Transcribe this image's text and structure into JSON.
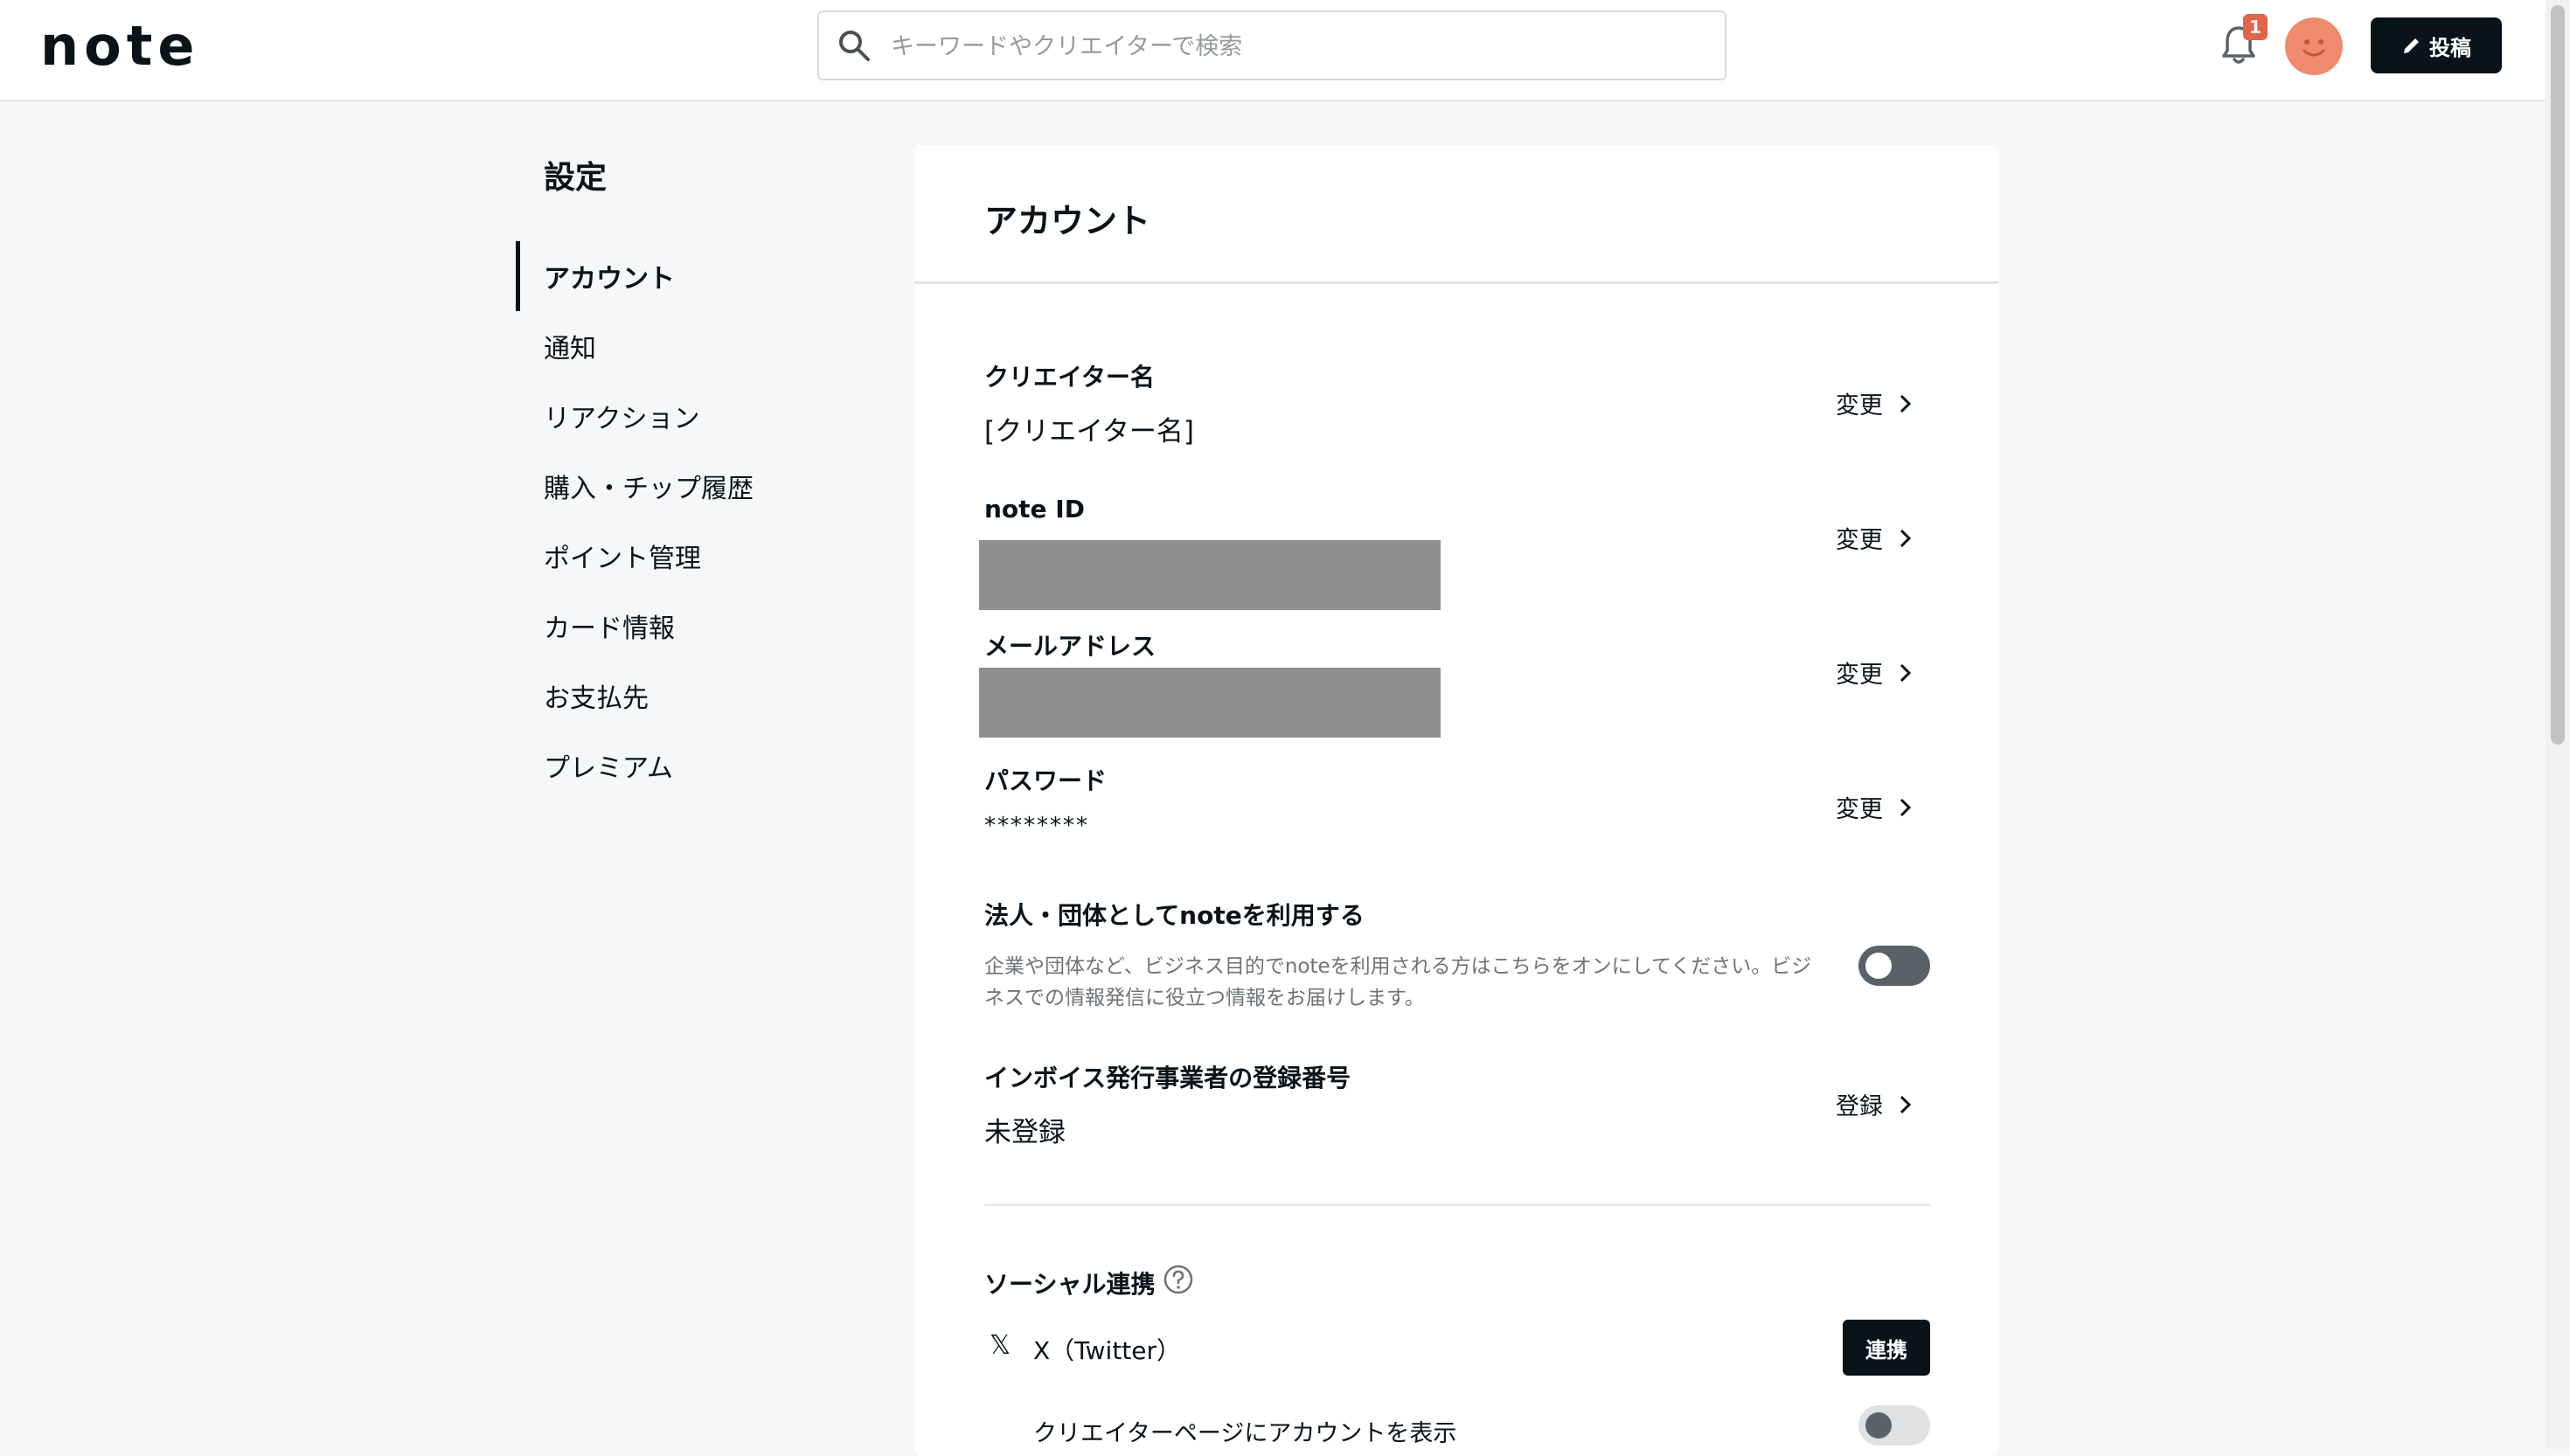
{
  "header": {
    "logo": "note",
    "search_placeholder": "キーワードやクリエイターで検索",
    "notification_count": "1",
    "post_label": "投稿"
  },
  "sidebar": {
    "title": "設定",
    "items": [
      {
        "label": "アカウント",
        "active": true
      },
      {
        "label": "通知"
      },
      {
        "label": "リアクション"
      },
      {
        "label": "購入・チップ履歴"
      },
      {
        "label": "ポイント管理"
      },
      {
        "label": "カード情報"
      },
      {
        "label": "お支払先"
      },
      {
        "label": "プレミアム"
      }
    ]
  },
  "account": {
    "title": "アカウント",
    "creator_name": {
      "label": "クリエイター名",
      "value": "[クリエイター名]",
      "action": "変更"
    },
    "note_id": {
      "label": "note ID",
      "action": "変更"
    },
    "email": {
      "label": "メールアドレス",
      "action": "変更"
    },
    "password": {
      "label": "パスワード",
      "value": "********",
      "action": "変更"
    },
    "corporate": {
      "label": "法人・団体としてnoteを利用する",
      "description": "企業や団体など、ビジネス目的でnoteを利用される方はこちらをオンにしてください。ビジネスでの情報発信に役立つ情報をお届けします。",
      "enabled": false
    },
    "invoice": {
      "label": "インボイス発行事業者の登録番号",
      "value": "未登録",
      "action": "登録"
    },
    "social": {
      "label": "ソーシャル連携",
      "twitter_label": "X（Twitter）",
      "link_label": "連携",
      "show_on_page_label": "クリエイターページにアカウントを表示",
      "show_on_page_enabled": false
    }
  },
  "colors": {
    "accent": "#08131a",
    "badge": "#e0654a",
    "avatar": "#f08a6c"
  }
}
